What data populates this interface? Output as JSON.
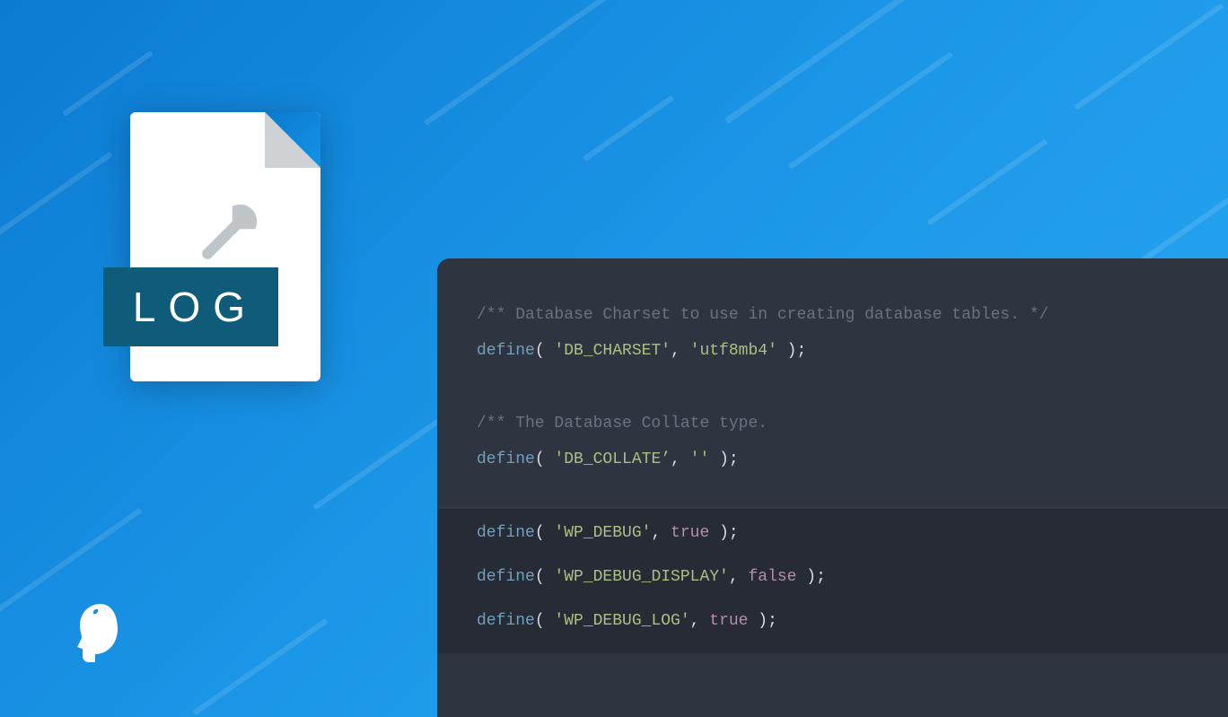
{
  "badge": {
    "label": "LOG"
  },
  "colors": {
    "bg_start": "#0b7ad1",
    "bg_end": "#2aa9f2",
    "panel": "#2e3440",
    "panel_highlight": "#262b35",
    "badge": "#0f5c7a",
    "comment": "#6b7280",
    "fn": "#6fa0bc",
    "string": "#a9c181",
    "bool": "#b48ead",
    "text": "#d8dee9"
  },
  "code": {
    "comment1": "/** Database Charset to use in creating database tables. */",
    "line1": {
      "fn": "define",
      "open": "( ",
      "str1": "'DB_CHARSET'",
      "sep": ", ",
      "str2": "'utf8mb4'",
      "close": " );"
    },
    "comment2": "/** The Database Collate type.",
    "line2": {
      "fn": "define",
      "open": "( ",
      "str1": "'DB_COLLATE’",
      "sep": ", ",
      "str2": "''",
      "close": " );"
    },
    "line3": {
      "fn": "define",
      "open": "( ",
      "str1": "'WP_DEBUG'",
      "sep": ", ",
      "bool": "true",
      "close": " );"
    },
    "line4": {
      "fn": "define",
      "open": "( ",
      "str1": "'WP_DEBUG_DISPLAY'",
      "sep": ", ",
      "bool": "false",
      "close": " );"
    },
    "line5": {
      "fn": "define",
      "open": "( ",
      "str1": "'WP_DEBUG_LOG'",
      "sep": ", ",
      "bool": "true",
      "close": " );"
    }
  }
}
